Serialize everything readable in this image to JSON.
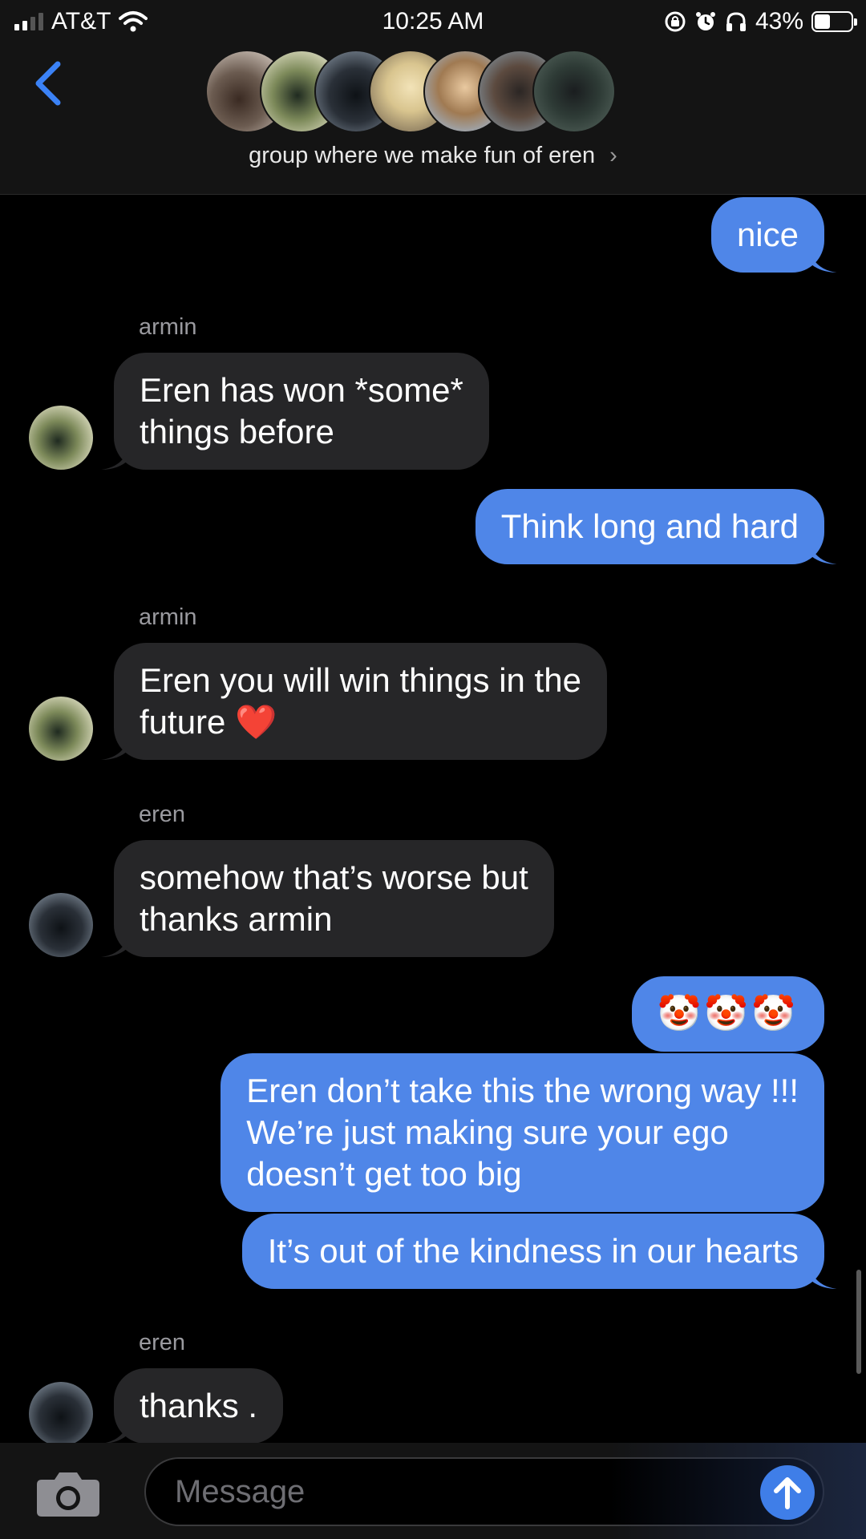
{
  "status_bar": {
    "carrier": "AT&T",
    "time": "10:25 AM",
    "battery": "43%",
    "battery_level": 0.43
  },
  "header": {
    "group_name": "group where we make fun of eren",
    "chevron": "›",
    "member_count_shown": 7
  },
  "messages": [
    {
      "side": "out",
      "text": "nice"
    },
    {
      "side": "in",
      "sender": "armin",
      "text": "Eren has won *some*\nthings before"
    },
    {
      "side": "out",
      "text": "Think long and hard"
    },
    {
      "side": "in",
      "sender": "armin",
      "text": "Eren you will win things in the\nfuture ❤️"
    },
    {
      "side": "in",
      "sender": "eren",
      "text": "somehow that’s worse but\nthanks armin"
    },
    {
      "side": "out",
      "text": "🤡🤡🤡"
    },
    {
      "side": "out",
      "text": "Eren don’t take this the wrong way !!!\nWe’re just making sure your ego\ndoesn’t get too big"
    },
    {
      "side": "out",
      "text": "It’s out of the kindness in our hearts"
    },
    {
      "side": "in",
      "sender": "eren",
      "text": "thanks ."
    }
  ],
  "input": {
    "placeholder": "Message"
  },
  "colors": {
    "outgoing_bubble": "#4f86e8",
    "incoming_bubble": "#262628",
    "accent": "#3b82f6"
  },
  "icons": {
    "back": "chevron-left-icon",
    "camera": "camera-icon",
    "send": "arrow-up-icon",
    "wifi": "wifi-icon",
    "lock": "orientation-lock-icon",
    "alarm": "alarm-icon",
    "headphones": "headphones-icon"
  }
}
